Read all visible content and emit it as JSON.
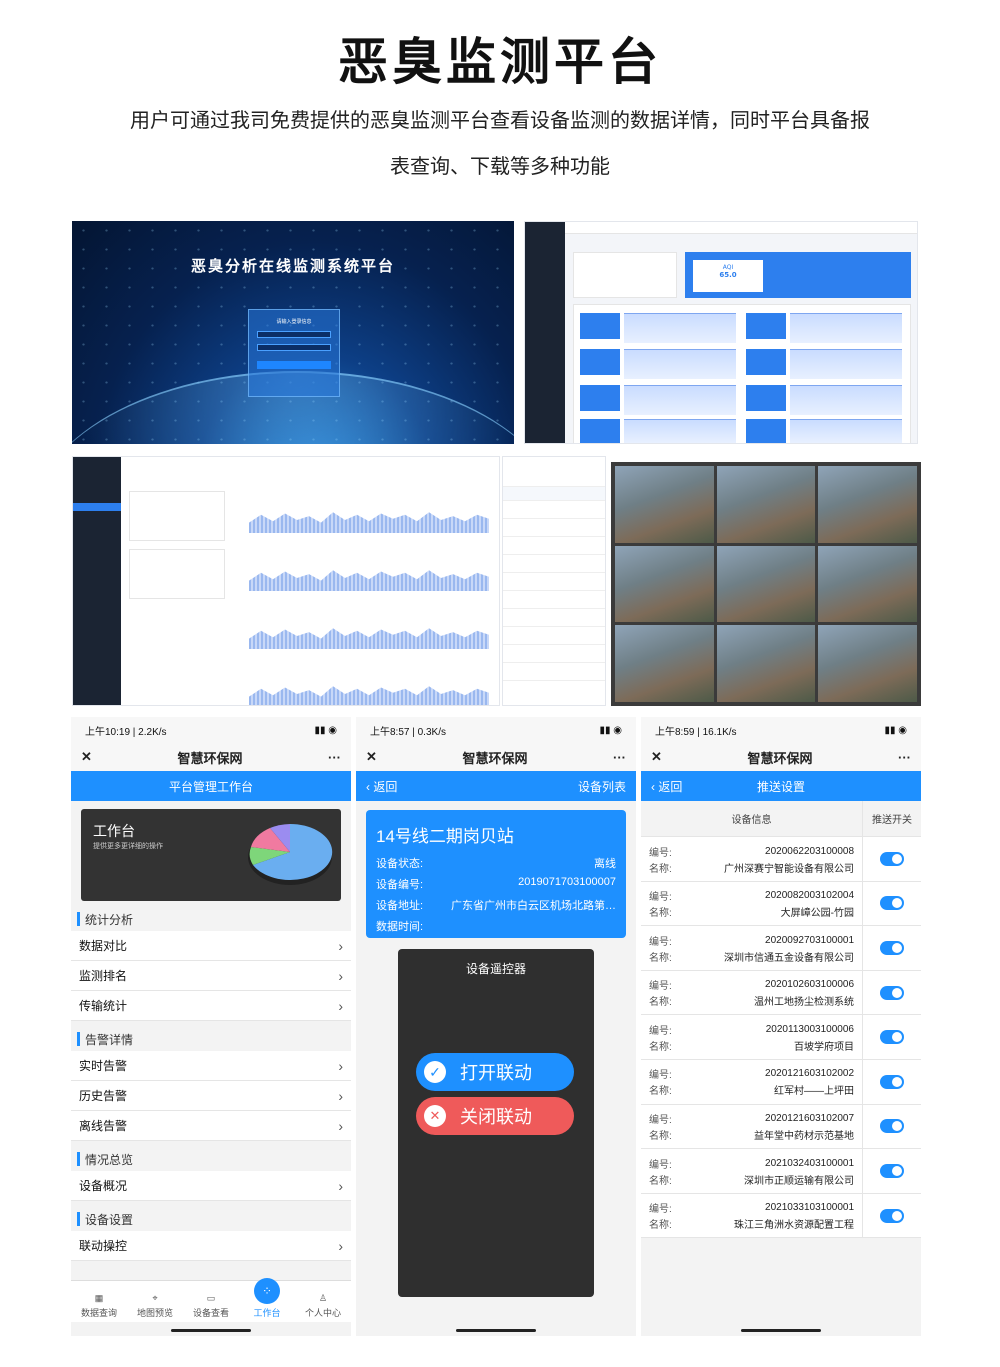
{
  "header": {
    "title": "恶臭监测平台",
    "line1": "用户可通过我司免费提供的恶臭监测平台查看设备监测的数据详情，同时平台具备报",
    "line2": "表查询、下载等多种功能"
  },
  "login": {
    "title": "恶臭分析在线监测系统平台",
    "box_title": "请输入登录信息"
  },
  "dashboard": {
    "aqi_label": "AQI",
    "aqi_value": "65.0"
  },
  "phone1": {
    "status_left": "上午10:19 | 2.2K/s",
    "app_title": "智慧环保网",
    "bar_title": "平台管理工作台",
    "card_title": "工作台",
    "card_sub": "提供更多更详细的操作",
    "sections": [
      {
        "title": "统计分析",
        "items": [
          "数据对比",
          "监测排名",
          "传输统计"
        ]
      },
      {
        "title": "告警详情",
        "items": [
          "实时告警",
          "历史告警",
          "离线告警"
        ]
      },
      {
        "title": "情况总览",
        "items": [
          "设备概况"
        ]
      },
      {
        "title": "设备设置",
        "items": [
          "联动操控"
        ]
      }
    ],
    "tabs": [
      "数据查询",
      "地图预览",
      "设备查看",
      "工作台",
      "个人中心"
    ]
  },
  "phone2": {
    "status_left": "上午8:57 | 0.3K/s",
    "app_title": "智慧环保网",
    "back": "返回",
    "bar_right": "设备列表",
    "station": "14号线二期岗贝站",
    "state_k": "设备状态:",
    "state_v": "离线",
    "code_k": "设备编号:",
    "code_v": "2019071703100007",
    "addr_k": "设备地址:",
    "addr_v": "广东省广州市白云区机场北路第…",
    "time_k": "数据时间:",
    "remote_title": "设备遥控器",
    "open": "打开联动",
    "close": "关闭联动"
  },
  "phone3": {
    "status_left": "上午8:59 | 16.1K/s",
    "app_title": "智慧环保网",
    "back": "返回",
    "bar_title": "推送设置",
    "col1": "设备信息",
    "col2": "推送开关",
    "code_k": "编号:",
    "name_k": "名称:",
    "rows": [
      {
        "code": "2020062203100008",
        "name": "广州深赛宁智能设备有限公司"
      },
      {
        "code": "2020082003102004",
        "name": "大屏嶂公园-竹园"
      },
      {
        "code": "2020092703100001",
        "name": "深圳市信通五金设备有限公司"
      },
      {
        "code": "2020102603100006",
        "name": "温州工地扬尘检测系统"
      },
      {
        "code": "2020113003100006",
        "name": "百坡学府项目"
      },
      {
        "code": "2020121603102002",
        "name": "红军村——上坪田"
      },
      {
        "code": "2020121603102007",
        "name": "益年堂中药材示范基地"
      },
      {
        "code": "2021032403100001",
        "name": "深圳市正顺运输有限公司"
      },
      {
        "code": "2021033103100001",
        "name": "珠江三角洲水资源配置工程"
      }
    ]
  },
  "colors": {
    "accent": "#1e90ff",
    "dark_panel": "#2f2f2f"
  }
}
